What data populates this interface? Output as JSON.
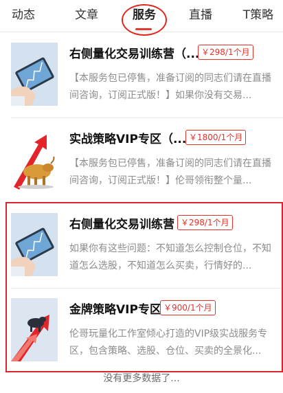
{
  "tabs": [
    {
      "label": "动态"
    },
    {
      "label": "文章"
    },
    {
      "label": "服务"
    },
    {
      "label": "直播"
    },
    {
      "label": "T策略"
    }
  ],
  "active_tab": "服务",
  "services": [
    {
      "title": "右侧量化交易训练营（...",
      "price": "￥298/1个月",
      "description": "【本服务包已停售，准备订阅的同志们请在直播间咨询，订阅正式版！】如果你没有交易..."
    },
    {
      "title": "实战策略VIP专区（...",
      "price": "￥1800/1个月",
      "description": "【本服务包已停售，准备订阅的同志们请在直播间咨询，订阅正式版！】伦哥领衔整个量..."
    },
    {
      "title": "右侧量化交易训练营",
      "price": "￥298/1个月",
      "description": "如果你有这些问题：不知道怎么控制仓位，不知道怎么选股，不知道怎么买卖，行情好的..."
    },
    {
      "title": "金牌策略VIP专区",
      "price": "￥900/1个月",
      "description": "伦哥玩量化工作室倾心打造的VIP级实战服务专区，包含策略、选股、仓位、买卖的全景化..."
    }
  ],
  "footer": {
    "no_more_text": "没有更多数据了..."
  },
  "colors": {
    "accent": "#e33a2e",
    "annotation": "#d9252b",
    "muted_text": "#8c8c8c"
  }
}
